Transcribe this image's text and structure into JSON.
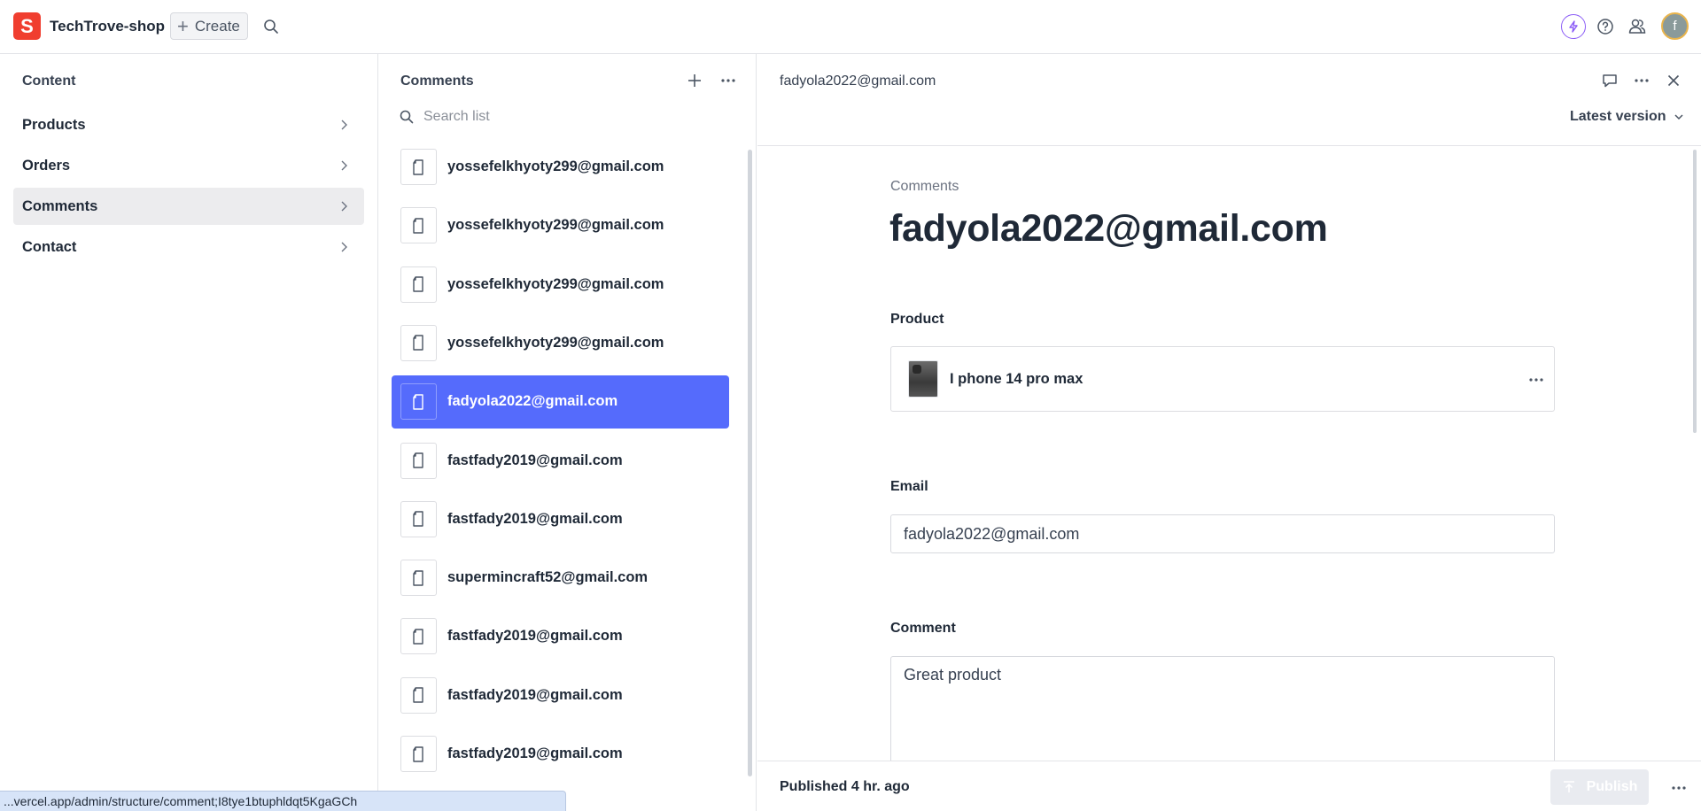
{
  "topbar": {
    "logo_letter": "S",
    "project_name": "TechTrove-shop",
    "create_label": "Create",
    "avatar_letter": "f"
  },
  "nav": {
    "title": "Content",
    "items": [
      {
        "label": "Products",
        "active": false
      },
      {
        "label": "Orders",
        "active": false
      },
      {
        "label": "Comments",
        "active": true
      },
      {
        "label": "Contact",
        "active": false
      }
    ]
  },
  "list": {
    "title": "Comments",
    "search_placeholder": "Search list",
    "items": [
      {
        "label": "yossefelkhyoty299@gmail.com",
        "selected": false
      },
      {
        "label": "yossefelkhyoty299@gmail.com",
        "selected": false
      },
      {
        "label": "yossefelkhyoty299@gmail.com",
        "selected": false
      },
      {
        "label": "yossefelkhyoty299@gmail.com",
        "selected": false
      },
      {
        "label": "fadyola2022@gmail.com",
        "selected": true
      },
      {
        "label": "fastfady2019@gmail.com",
        "selected": false
      },
      {
        "label": "fastfady2019@gmail.com",
        "selected": false
      },
      {
        "label": "supermincraft52@gmail.com",
        "selected": false
      },
      {
        "label": "fastfady2019@gmail.com",
        "selected": false
      },
      {
        "label": "fastfady2019@gmail.com",
        "selected": false
      },
      {
        "label": "fastfady2019@gmail.com",
        "selected": false
      }
    ]
  },
  "detail": {
    "header_title": "fadyola2022@gmail.com",
    "version_label": "Latest version",
    "doc_type": "Comments",
    "heading": "fadyola2022@gmail.com",
    "product": {
      "label": "Product",
      "name": "I phone 14 pro max"
    },
    "email": {
      "label": "Email",
      "value": "fadyola2022@gmail.com"
    },
    "comment": {
      "label": "Comment",
      "value": "Great product"
    },
    "footer": {
      "status_prefix": "Published",
      "status_time": "4 hr. ago",
      "publish_label": "Publish"
    }
  },
  "status_bar": {
    "url": "...vercel.app/admin/structure/comment;I8tye1btuphldqt5KgaGCh"
  },
  "colors": {
    "brand": "#f03e2f",
    "selected": "#556bfc",
    "accent_bolt": "#8b5cf6"
  }
}
